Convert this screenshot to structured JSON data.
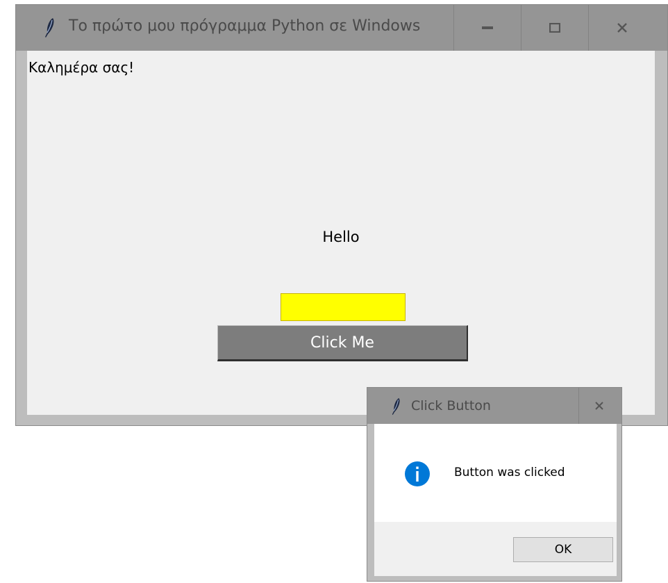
{
  "main_window": {
    "title": "Το πρώτο μου πρόγραμμα Python σε Windows",
    "greeting": "Καλημέρα σας!",
    "hello_label": "Hello",
    "entry_value": "",
    "entry_color": "#ffff00",
    "button_label": "Click Me",
    "controls": [
      "minimize-icon",
      "maximize-icon",
      "close-icon"
    ]
  },
  "dialog": {
    "title": "Click Button",
    "message": "Button was clicked",
    "icon": "info-icon",
    "ok_label": "OK",
    "accent_color": "#0078d7"
  }
}
